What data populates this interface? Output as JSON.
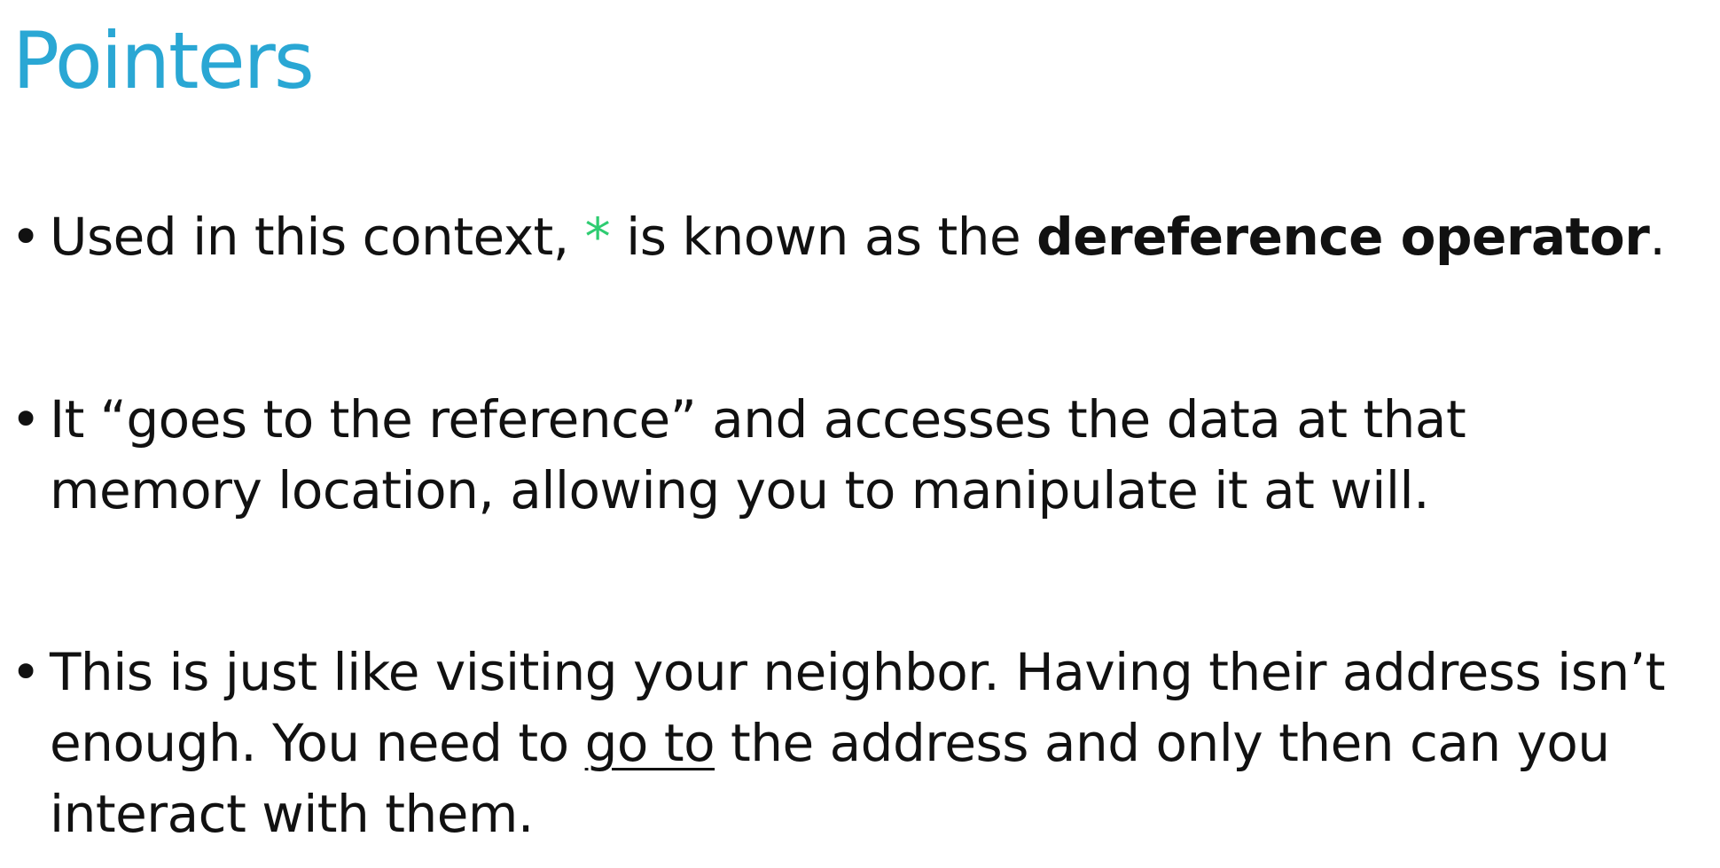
{
  "colors": {
    "title": "#2aa7d4",
    "star": "#2ecc71",
    "text": "#111111",
    "background": "#ffffff"
  },
  "slide": {
    "title": "Pointers",
    "bullet_glyph": "•",
    "bullets": [
      {
        "lines": [
          {
            "p1": "Used in this context, ",
            "star": "*",
            "p2": " is known as the ",
            "bold": "dereference operator",
            "p3": "."
          }
        ]
      },
      {
        "lines": [
          "It “goes to the reference” and accesses the data at that",
          "memory location, allowing you to manipulate it at will."
        ]
      },
      {
        "lines": [
          "This is just like visiting your neighbor. Having their address isn’t",
          {
            "p1": "enough. You need to ",
            "underlined": "go to",
            "p2": " the address and only then can you"
          },
          "interact with them."
        ]
      }
    ]
  }
}
